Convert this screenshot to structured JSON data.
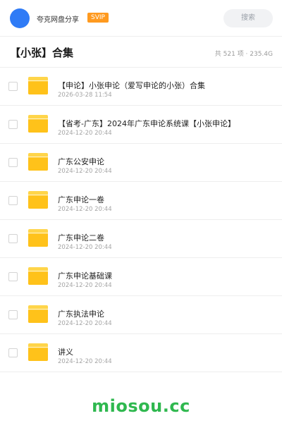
{
  "header": {
    "brand": "夸克网盘分享",
    "badge": "SVIP",
    "search_label": "搜索"
  },
  "collection": {
    "title": "【小张】合集",
    "summary": "共 521 项 · 235.4G"
  },
  "files": [
    {
      "name": "【申论】小张申论（爱写申论的小张）合集",
      "date": "2026-03-28 11:54",
      "icon": "folder-icon"
    },
    {
      "name": "【省考-广东】2024年广东申论系统课【小张申论】",
      "date": "2024-12-20 20:44",
      "icon": "folder-icon"
    },
    {
      "name": "广东公安申论",
      "date": "2024-12-20 20:44",
      "icon": "folder-icon"
    },
    {
      "name": "广东申论一卷",
      "date": "2024-12-20 20:44",
      "icon": "folder-icon"
    },
    {
      "name": "广东申论二卷",
      "date": "2024-12-20 20:44",
      "icon": "folder-icon"
    },
    {
      "name": "广东申论基础课",
      "date": "2024-12-20 20:44",
      "icon": "folder-icon"
    },
    {
      "name": "广东执法申论",
      "date": "2024-12-20 20:44",
      "icon": "folder-icon"
    },
    {
      "name": "讲义",
      "date": "2024-12-20 20:44",
      "icon": "folder-icon"
    }
  ],
  "watermark": "miosou.cc",
  "colors": {
    "accent": "#2f7bf6",
    "badge": "#ff9a1f",
    "folder": "#ffc21a",
    "watermark": "#2fb84f"
  }
}
